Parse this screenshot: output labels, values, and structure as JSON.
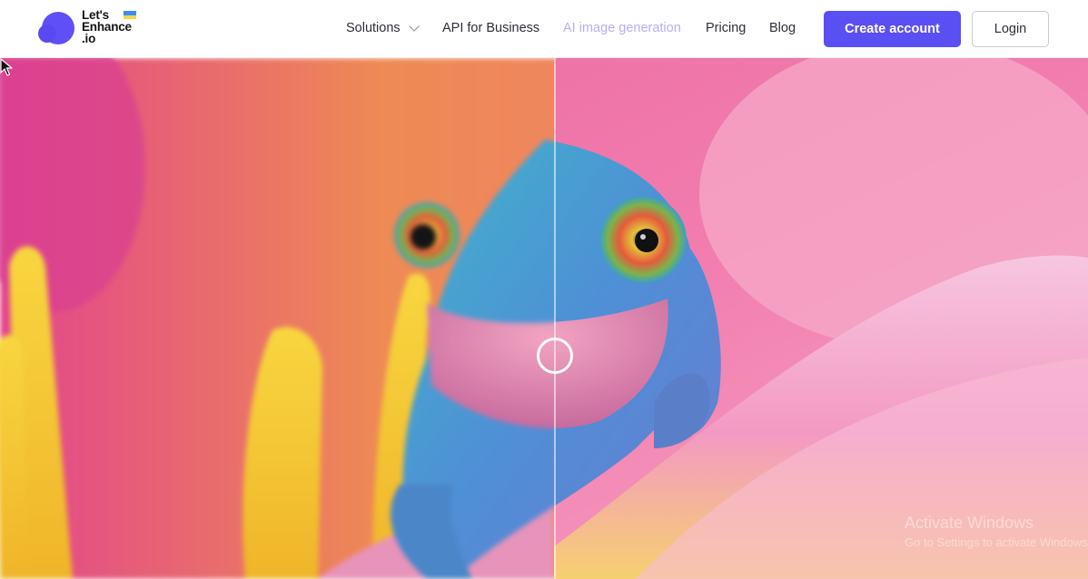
{
  "header": {
    "logo": {
      "lines": [
        "Let's",
        "Enhance",
        ".io"
      ]
    },
    "nav": [
      {
        "label": "Solutions",
        "has_dropdown": true
      },
      {
        "label": "API for Business"
      },
      {
        "label": "AI image generation"
      },
      {
        "label": "Pricing"
      },
      {
        "label": "Blog"
      }
    ],
    "create_account_label": "Create account",
    "login_label": "Login"
  },
  "hero": {
    "comparison_split": 0.51
  },
  "watermark": {
    "title": "Activate Windows",
    "subtitle": "Go to Settings to activate Windows."
  },
  "colors": {
    "brand": "#5a4ff2",
    "nav_text": "#2e2e3a",
    "nav_muted": "#b6aef5"
  }
}
